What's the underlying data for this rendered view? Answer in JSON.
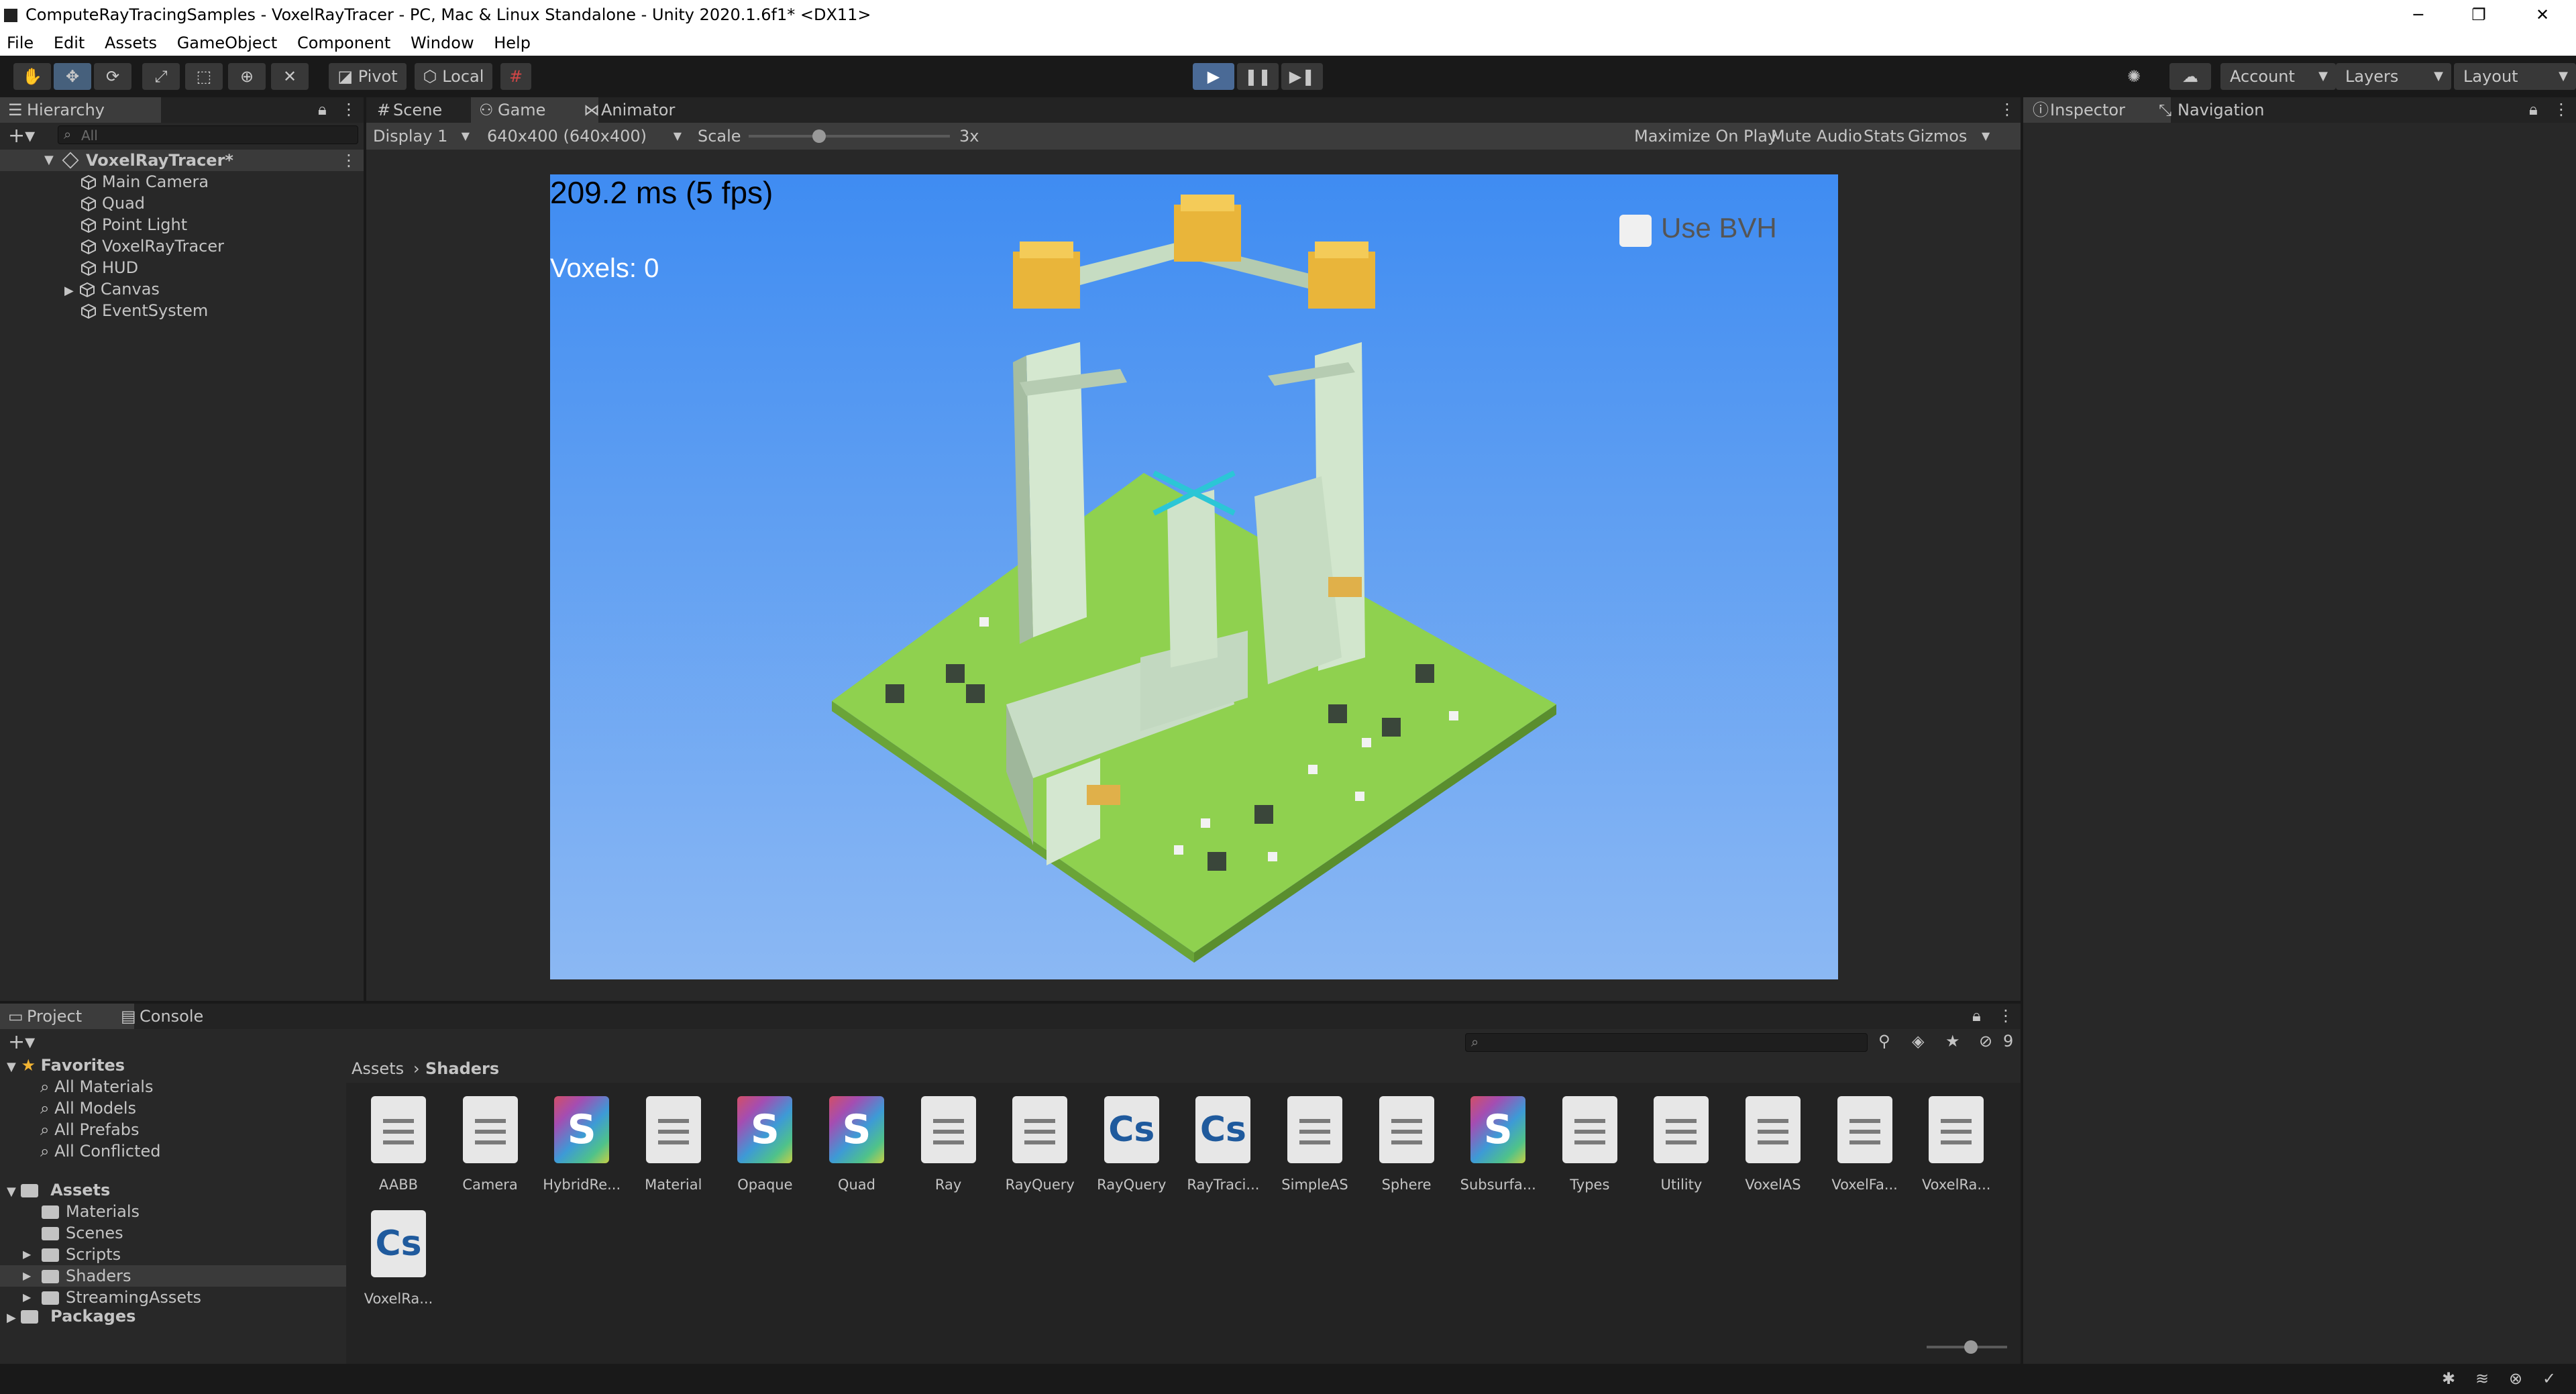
{
  "window": {
    "title": "ComputeRayTracingSamples - VoxelRayTracer - PC, Mac & Linux Standalone - Unity 2020.1.6f1* <DX11>",
    "controls": [
      "─",
      "❐",
      "✕"
    ]
  },
  "menubar": [
    "File",
    "Edit",
    "Assets",
    "GameObject",
    "Component",
    "Window",
    "Help"
  ],
  "toolbar": {
    "pivot": "Pivot",
    "local": "Local",
    "account": "Account",
    "layers": "Layers",
    "layout": "Layout"
  },
  "hierarchy": {
    "tab": "Hierarchy",
    "search_placeholder": "All",
    "scene": "VoxelRayTracer*",
    "items": [
      "Main Camera",
      "Quad",
      "Point Light",
      "VoxelRayTracer",
      "HUD",
      "Canvas",
      "EventSystem"
    ]
  },
  "center": {
    "tabs": [
      "Scene",
      "Game",
      "Animator"
    ],
    "display": "Display 1",
    "resolution": "640x400 (640x400)",
    "scale_label": "Scale",
    "scale_value": "3x",
    "scale_level": 0.35,
    "options": [
      "Maximize On Play",
      "Mute Audio",
      "Stats",
      "Gizmos"
    ]
  },
  "game_view": {
    "fps": "209.2 ms (5 fps)",
    "voxels": "Voxels: 0",
    "bvh_label": "Use BVH",
    "sky_top": "#3f8cf2",
    "sky_bottom": "#8bb8f3",
    "grass": "#8fd14f"
  },
  "inspector": {
    "tabs": [
      "Inspector",
      "Navigation"
    ]
  },
  "project": {
    "tabs": [
      "Project",
      "Console"
    ],
    "favorites_label": "Favorites",
    "favorites": [
      "All Materials",
      "All Models",
      "All Prefabs",
      "All Conflicted"
    ],
    "assets_label": "Assets",
    "assets_folders": [
      "Materials",
      "Scenes",
      "Scripts",
      "Shaders",
      "StreamingAssets"
    ],
    "packages_label": "Packages",
    "breadcrumb": [
      "Assets",
      "Shaders"
    ],
    "hidden_count": "9",
    "files": [
      {
        "name": "AABB",
        "kind": "doc"
      },
      {
        "name": "Camera",
        "kind": "doc"
      },
      {
        "name": "HybridRe...",
        "kind": "shader"
      },
      {
        "name": "Material",
        "kind": "doc"
      },
      {
        "name": "Opaque",
        "kind": "shader"
      },
      {
        "name": "Quad",
        "kind": "shader"
      },
      {
        "name": "Ray",
        "kind": "doc"
      },
      {
        "name": "RayQuery",
        "kind": "doc"
      },
      {
        "name": "RayQuery",
        "kind": "cs"
      },
      {
        "name": "RayTraci...",
        "kind": "cs"
      },
      {
        "name": "SimpleAS",
        "kind": "doc"
      },
      {
        "name": "Sphere",
        "kind": "doc"
      },
      {
        "name": "Subsurfa...",
        "kind": "shader"
      },
      {
        "name": "Types",
        "kind": "doc"
      },
      {
        "name": "Utility",
        "kind": "doc"
      },
      {
        "name": "VoxelAS",
        "kind": "doc"
      },
      {
        "name": "VoxelFa...",
        "kind": "doc"
      },
      {
        "name": "VoxelRa...",
        "kind": "doc"
      },
      {
        "name": "VoxelRa...",
        "kind": "cs"
      }
    ],
    "shader_letter": "S",
    "cs_letter": "Cs"
  }
}
